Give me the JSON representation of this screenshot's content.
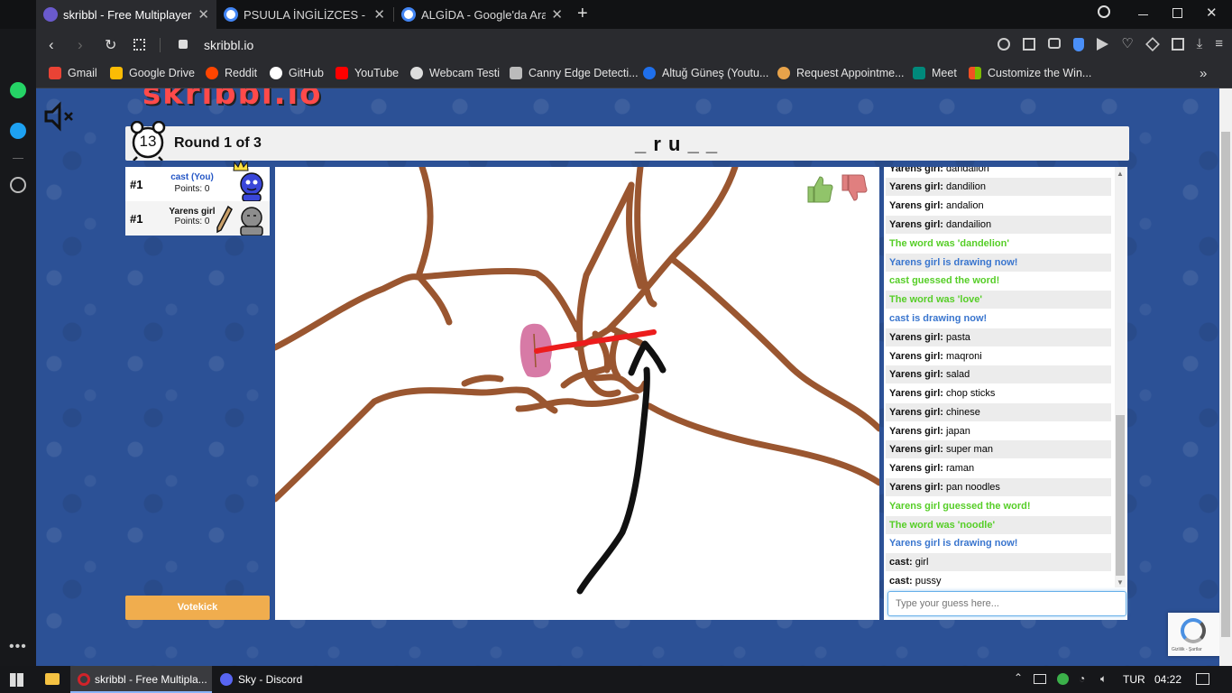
{
  "browser": {
    "tabs": [
      {
        "title": "skribbl - Free Multiplayer D",
        "active": true,
        "favicon_color": "#6a5acd"
      },
      {
        "title": "PSUULA İNGİLİZCES - Goo",
        "active": false,
        "favicon_color": "#4285f4"
      },
      {
        "title": "ALGİDA - Google'da Ara",
        "active": false,
        "favicon_color": "#4285f4"
      }
    ],
    "url": "skribbl.io",
    "bookmarks": [
      {
        "label": "Gmail",
        "color": "#ea4335"
      },
      {
        "label": "Google Drive",
        "color": "#fbbc04"
      },
      {
        "label": "Reddit",
        "color": "#ff4500"
      },
      {
        "label": "GitHub",
        "color": "#ffffff"
      },
      {
        "label": "YouTube",
        "color": "#ff0000"
      },
      {
        "label": "Webcam Testi",
        "color": "#dddddd"
      },
      {
        "label": "Canny Edge Detecti...",
        "color": "#bbbbbb"
      },
      {
        "label": "Altuğ Güneş (Youtu...",
        "color": "#1f6feb"
      },
      {
        "label": "Request Appointme...",
        "color": "#e8a34a"
      },
      {
        "label": "Meet",
        "color": "#00897b"
      },
      {
        "label": "Customize the Win...",
        "color": "#f25022"
      }
    ]
  },
  "game": {
    "logo_text": "skribbl.io",
    "timer": "13",
    "round_text": "Round 1 of 3",
    "word_hint": "_ r u _ _",
    "players": [
      {
        "rank": "#1",
        "name": "cast (You)",
        "points": "Points: 0",
        "is_you": true
      },
      {
        "rank": "#1",
        "name": "Yarens girl",
        "points": "Points: 0",
        "is_you": false
      }
    ],
    "votekick_label": "Votekick",
    "chat_messages": [
      {
        "type": "guess",
        "user": "Yarens girl:",
        "text": "dandalion"
      },
      {
        "type": "guess",
        "user": "Yarens girl:",
        "text": "dandilion"
      },
      {
        "type": "guess",
        "user": "Yarens girl:",
        "text": "andalion"
      },
      {
        "type": "guess",
        "user": "Yarens girl:",
        "text": "dandailion"
      },
      {
        "type": "green",
        "text": "The word was 'dandelion'"
      },
      {
        "type": "blue",
        "text": "Yarens girl is drawing now!"
      },
      {
        "type": "green",
        "text": "cast guessed the word!"
      },
      {
        "type": "green",
        "text": "The word was 'love'"
      },
      {
        "type": "blue",
        "text": "cast is drawing now!"
      },
      {
        "type": "guess",
        "user": "Yarens girl:",
        "text": "pasta"
      },
      {
        "type": "guess",
        "user": "Yarens girl:",
        "text": "maqroni"
      },
      {
        "type": "guess",
        "user": "Yarens girl:",
        "text": "salad"
      },
      {
        "type": "guess",
        "user": "Yarens girl:",
        "text": "chop sticks"
      },
      {
        "type": "guess",
        "user": "Yarens girl:",
        "text": "chinese"
      },
      {
        "type": "guess",
        "user": "Yarens girl:",
        "text": "japan"
      },
      {
        "type": "guess",
        "user": "Yarens girl:",
        "text": "super man"
      },
      {
        "type": "guess",
        "user": "Yarens girl:",
        "text": "raman"
      },
      {
        "type": "guess",
        "user": "Yarens girl:",
        "text": "pan noodles"
      },
      {
        "type": "green",
        "text": "Yarens girl guessed the word!"
      },
      {
        "type": "green",
        "text": "The word was 'noodle'"
      },
      {
        "type": "blue",
        "text": "Yarens girl is drawing now!"
      },
      {
        "type": "guess",
        "user": "cast:",
        "text": "girl"
      },
      {
        "type": "guess",
        "user": "cast:",
        "text": "pussy"
      }
    ],
    "chat_placeholder": "Type your guess here...",
    "recaptcha_text": "Gizlilik - Şartlar"
  },
  "taskbar": {
    "items": [
      {
        "label": "skribbl - Free Multipla...",
        "color": "#d1232a"
      },
      {
        "label": "Sky - Discord",
        "color": "#5865f2"
      }
    ],
    "language": "TUR",
    "time": "04:22"
  }
}
